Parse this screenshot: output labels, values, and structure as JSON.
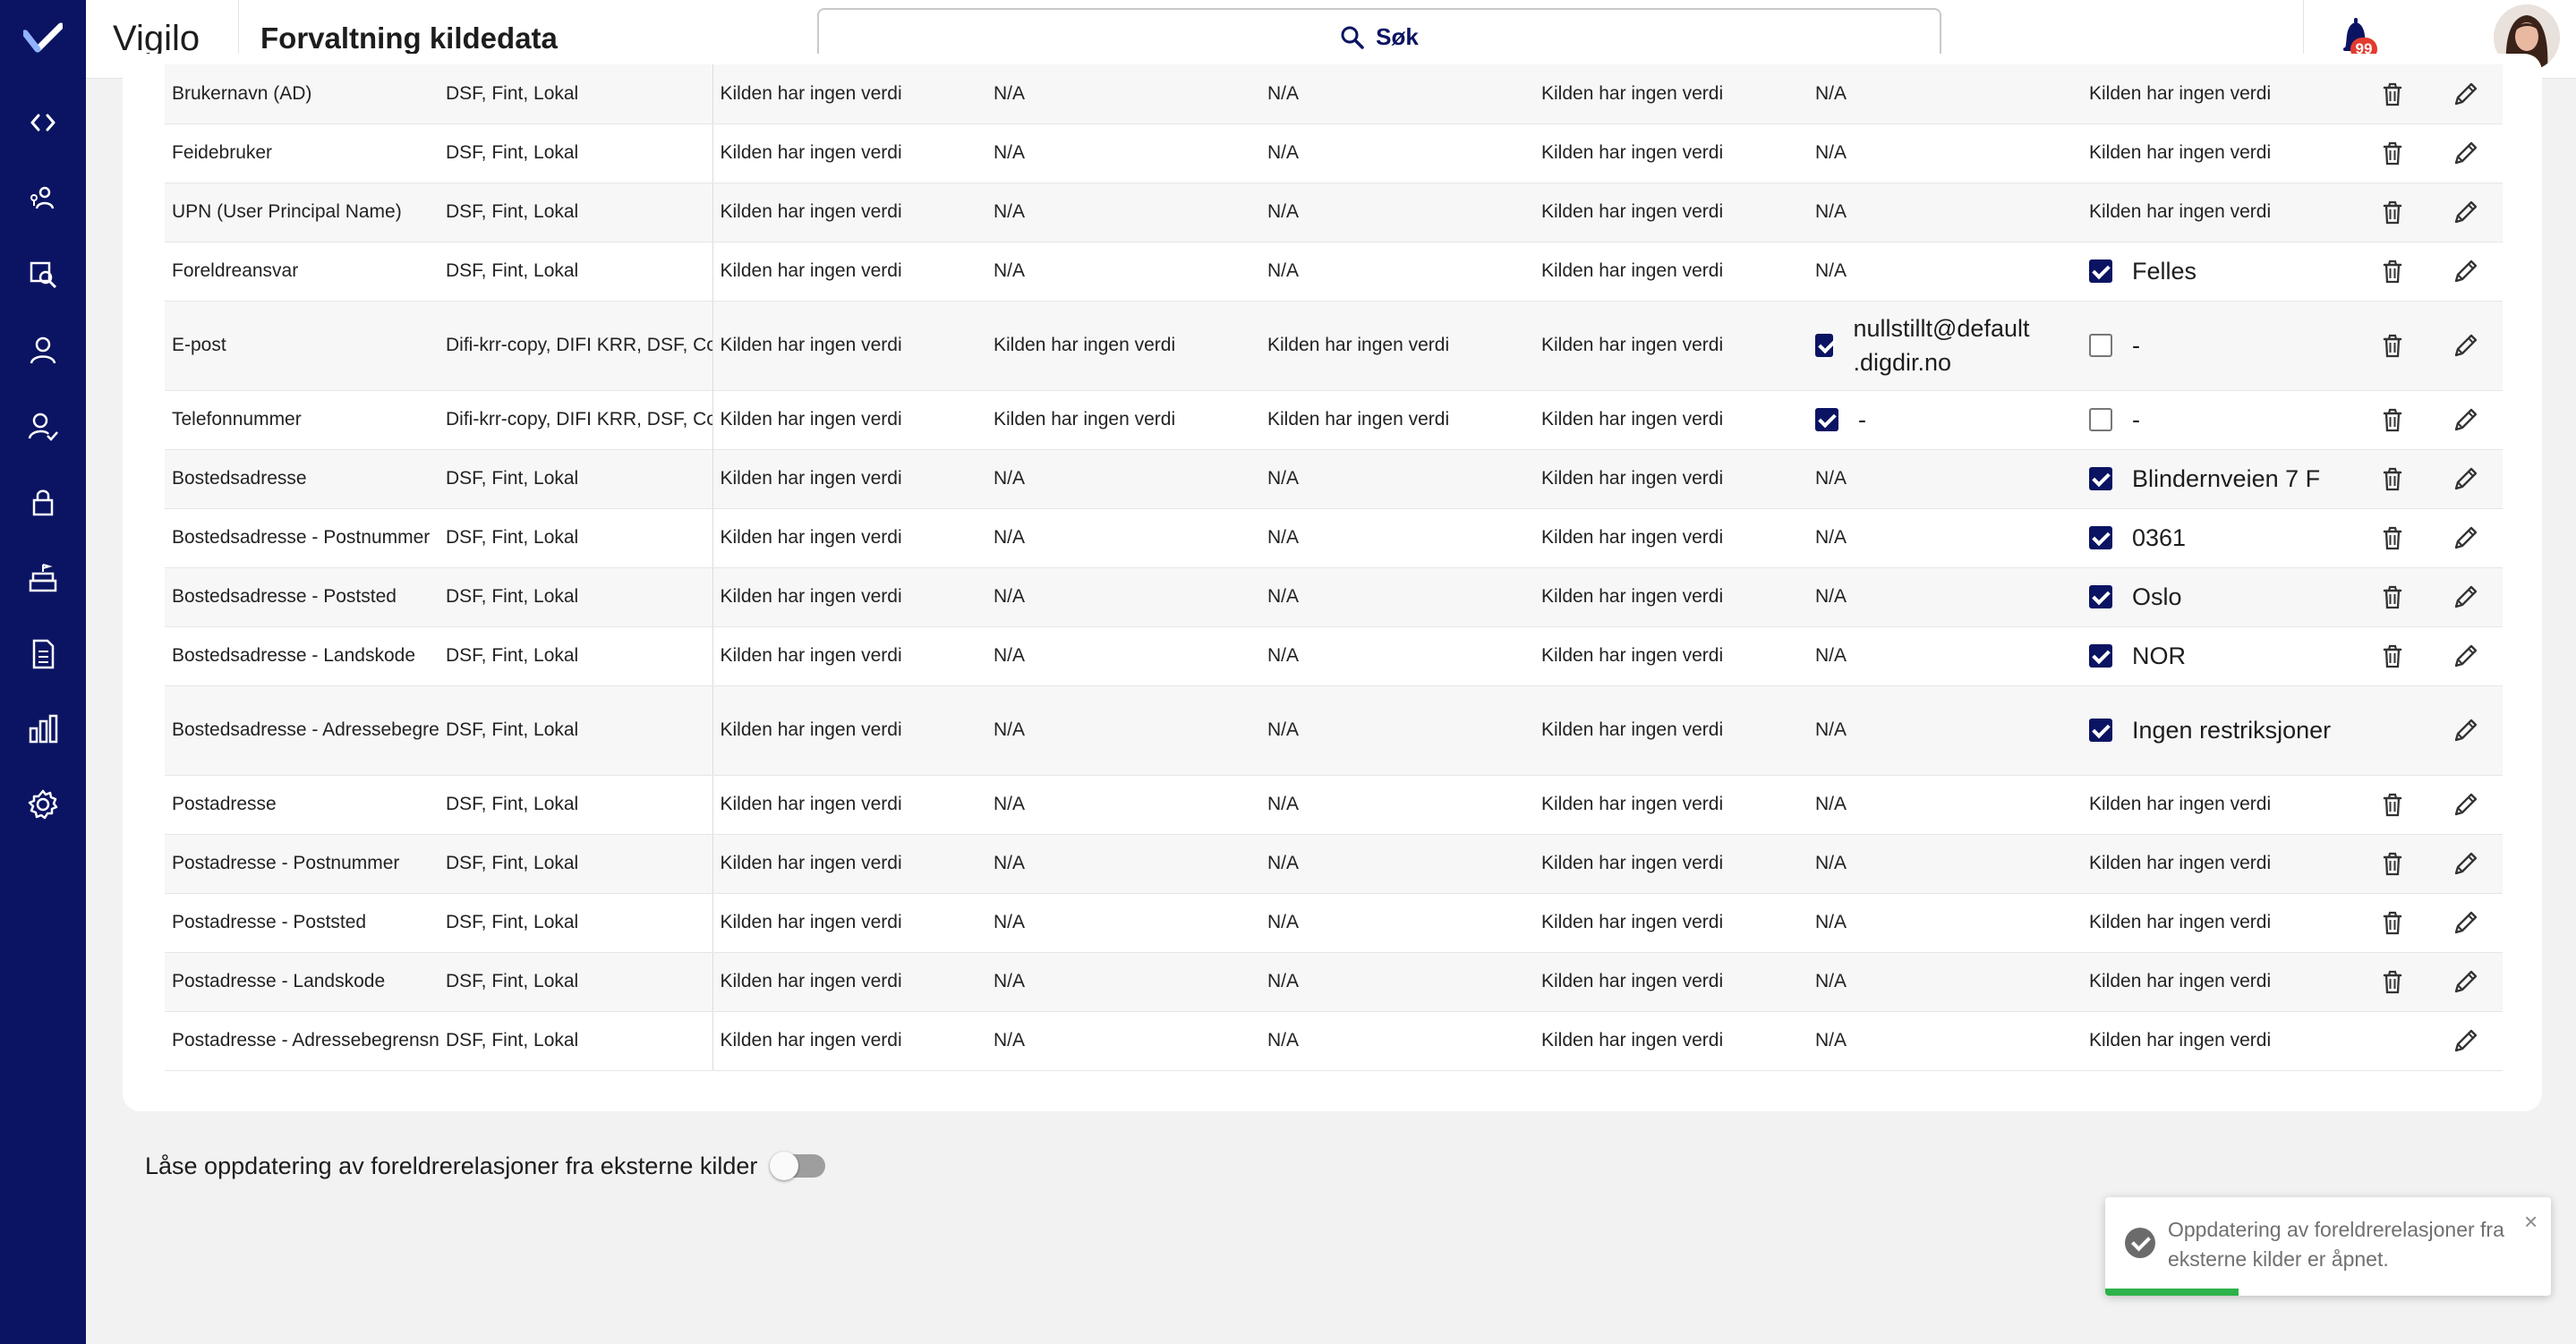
{
  "app": {
    "brand": "Vigilo",
    "page_title": "Forvaltning kildedata"
  },
  "search": {
    "label": "Søk"
  },
  "notifications": {
    "count": "99"
  },
  "nav": [
    {
      "icon": "code-icon"
    },
    {
      "icon": "users-network-icon"
    },
    {
      "icon": "user-search-icon"
    },
    {
      "icon": "user-icon"
    },
    {
      "icon": "user-check-icon"
    },
    {
      "icon": "lock-icon"
    },
    {
      "icon": "school-building-icon"
    },
    {
      "icon": "document-icon"
    },
    {
      "icon": "bar-chart-icon"
    },
    {
      "icon": "gear-icon"
    }
  ],
  "table": {
    "rows": [
      {
        "name": "Brukernavn (AD)",
        "sources": "DSF, Fint, Lokal",
        "c1": "Kilden har ingen verdi",
        "c2": "N/A",
        "c3": "N/A",
        "c4": "Kilden har ingen verdi",
        "c5": "N/A",
        "c6": "Kilden har ingen verdi"
      },
      {
        "name": "Feidebruker",
        "sources": "DSF, Fint, Lokal",
        "c1": "Kilden har ingen verdi",
        "c2": "N/A",
        "c3": "N/A",
        "c4": "Kilden har ingen verdi",
        "c5": "N/A",
        "c6": "Kilden har ingen verdi"
      },
      {
        "name": "UPN (User Principal Name)",
        "sources": "DSF, Fint, Lokal",
        "c1": "Kilden har ingen verdi",
        "c2": "N/A",
        "c3": "N/A",
        "c4": "Kilden har ingen verdi",
        "c5": "N/A",
        "c6": "Kilden har ingen verdi"
      },
      {
        "name": "Foreldreansvar",
        "sources": "DSF, Fint, Lokal",
        "c1": "Kilden har ingen verdi",
        "c2": "N/A",
        "c3": "N/A",
        "c4": "Kilden har ingen verdi",
        "c5": "N/A",
        "c6": "Felles",
        "c6_checked": true
      },
      {
        "name": "E-post",
        "sources": "Difi-krr-copy, DIFI KRR, DSF, Core-a",
        "c1": "Kilden har ingen verdi",
        "c2": "Kilden har ingen verdi",
        "c3": "Kilden har ingen verdi",
        "c4": "Kilden har ingen verdi",
        "c5": "nullstillt@default .digdir.no",
        "c5_checked": true,
        "c6": "-",
        "c6_checked": false
      },
      {
        "name": "Telefonnummer",
        "sources": "Difi-krr-copy, DIFI KRR, DSF, Core-a",
        "c1": "Kilden har ingen verdi",
        "c2": "Kilden har ingen verdi",
        "c3": "Kilden har ingen verdi",
        "c4": "Kilden har ingen verdi",
        "c5": "-",
        "c5_checked": true,
        "c6": "-",
        "c6_checked": false
      },
      {
        "name": "Bostedsadresse",
        "sources": "DSF, Fint, Lokal",
        "c1": "Kilden har ingen verdi",
        "c2": "N/A",
        "c3": "N/A",
        "c4": "Kilden har ingen verdi",
        "c5": "N/A",
        "c6": "Blindernveien 7 F",
        "c6_checked": true
      },
      {
        "name": "Bostedsadresse - Postnummer",
        "sources": "DSF, Fint, Lokal",
        "c1": "Kilden har ingen verdi",
        "c2": "N/A",
        "c3": "N/A",
        "c4": "Kilden har ingen verdi",
        "c5": "N/A",
        "c6": "0361",
        "c6_checked": true
      },
      {
        "name": "Bostedsadresse - Poststed",
        "sources": "DSF, Fint, Lokal",
        "c1": "Kilden har ingen verdi",
        "c2": "N/A",
        "c3": "N/A",
        "c4": "Kilden har ingen verdi",
        "c5": "N/A",
        "c6": "Oslo",
        "c6_checked": true
      },
      {
        "name": "Bostedsadresse - Landskode",
        "sources": "DSF, Fint, Lokal",
        "c1": "Kilden har ingen verdi",
        "c2": "N/A",
        "c3": "N/A",
        "c4": "Kilden har ingen verdi",
        "c5": "N/A",
        "c6": "NOR",
        "c6_checked": true
      },
      {
        "name": "Bostedsadresse - Adressebegrensning",
        "sources": "DSF, Fint, Lokal",
        "c1": "Kilden har ingen verdi",
        "c2": "N/A",
        "c3": "N/A",
        "c4": "Kilden har ingen verdi",
        "c5": "N/A",
        "c6": "Ingen restriksjoner",
        "c6_checked": true,
        "no_delete": true
      },
      {
        "name": "Postadresse",
        "sources": "DSF, Fint, Lokal",
        "c1": "Kilden har ingen verdi",
        "c2": "N/A",
        "c3": "N/A",
        "c4": "Kilden har ingen verdi",
        "c5": "N/A",
        "c6": "Kilden har ingen verdi"
      },
      {
        "name": "Postadresse - Postnummer",
        "sources": "DSF, Fint, Lokal",
        "c1": "Kilden har ingen verdi",
        "c2": "N/A",
        "c3": "N/A",
        "c4": "Kilden har ingen verdi",
        "c5": "N/A",
        "c6": "Kilden har ingen verdi"
      },
      {
        "name": "Postadresse - Poststed",
        "sources": "DSF, Fint, Lokal",
        "c1": "Kilden har ingen verdi",
        "c2": "N/A",
        "c3": "N/A",
        "c4": "Kilden har ingen verdi",
        "c5": "N/A",
        "c6": "Kilden har ingen verdi"
      },
      {
        "name": "Postadresse - Landskode",
        "sources": "DSF, Fint, Lokal",
        "c1": "Kilden har ingen verdi",
        "c2": "N/A",
        "c3": "N/A",
        "c4": "Kilden har ingen verdi",
        "c5": "N/A",
        "c6": "Kilden har ingen verdi"
      },
      {
        "name": "Postadresse - Adressebegrensning",
        "sources": "DSF, Fint, Lokal",
        "c1": "Kilden har ingen verdi",
        "c2": "N/A",
        "c3": "N/A",
        "c4": "Kilden har ingen verdi",
        "c5": "N/A",
        "c6": "Kilden har ingen verdi",
        "no_delete": true
      }
    ]
  },
  "lock_toggle": {
    "label": "Låse oppdatering av foreldrerelasjoner fra eksterne kilder",
    "enabled": false
  },
  "toast": {
    "message": "Oppdatering av foreldrerelasjoner fra eksterne kilder er åpnet.",
    "close": "×",
    "progress": 0.3,
    "progress_color": "#2eb24a"
  },
  "colors": {
    "brand_navy": "#0b1462",
    "badge_red": "#e33b2e"
  }
}
